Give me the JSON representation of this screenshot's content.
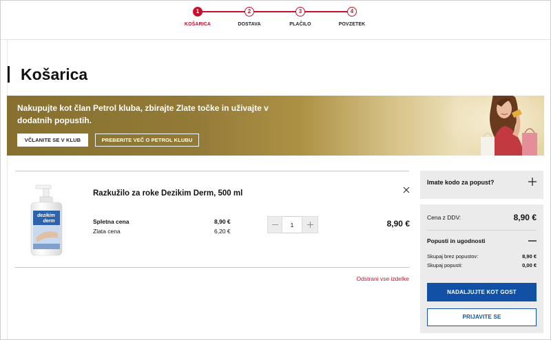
{
  "stepper": {
    "steps": [
      {
        "number": "1",
        "label": "KOŠARICA",
        "active": true
      },
      {
        "number": "2",
        "label": "DOSTAVA",
        "active": false
      },
      {
        "number": "3",
        "label": "PLAČILO",
        "active": false
      },
      {
        "number": "4",
        "label": "POVZETEK",
        "active": false
      }
    ]
  },
  "page_title": "Košarica",
  "banner": {
    "text": "Nakupujte kot član Petrol kluba, zbirajte Zlate točke in uživajte v dodatnih popustih.",
    "join_button": "VČLANITE SE V KLUB",
    "more_button": "PREBERITE VEČ O PETROL KLUBU"
  },
  "cart": {
    "items": [
      {
        "name": "Razkužilo za roke Dezikim Derm, 500 ml",
        "image_label": [
          "dezikim",
          "derm"
        ],
        "web_price_label": "Spletna cena",
        "web_price": "8,90 €",
        "gold_price_label": "Zlata cena",
        "gold_price": "6,20 €",
        "quantity": "1",
        "total": "8,90 €"
      }
    ],
    "remove_all": "Odstrani vse izdelke"
  },
  "summary": {
    "discount_code_label": "Imate kodo za popust?",
    "price_with_vat_label": "Cena z DDV:",
    "price_with_vat": "8,90 €",
    "discounts_label": "Popusti in ugodnosti",
    "total_without_discounts_label": "Skupaj brez popustov:",
    "total_without_discounts": "8,90 €",
    "total_discounts_label": "Skupaj popusti:",
    "total_discounts": "0,00 €",
    "guest_button": "NADALJUJTE KOT GOST",
    "login_button": "PRIJAVITE SE"
  },
  "colors": {
    "accent": "#c8102e",
    "primary_button": "#1150a5"
  }
}
